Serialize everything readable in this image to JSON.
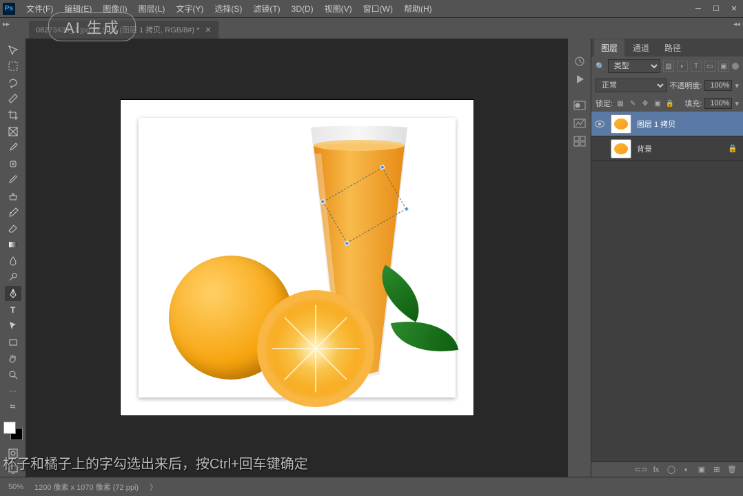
{
  "menu": {
    "items": [
      "文件(F)",
      "编辑(E)",
      "图像(I)",
      "图层(L)",
      "文字(Y)",
      "选择(S)",
      "滤镜(T)",
      "3D(D)",
      "视图(V)",
      "窗口(W)",
      "帮助(H)"
    ]
  },
  "tab": {
    "title": "08273439_1.jpg @ 50% (图层 1 拷贝, RGB/8#) *"
  },
  "ai_badge": "AI 生成",
  "panels": {
    "tabs": [
      "图层",
      "通道",
      "路径"
    ],
    "filter_label": "类型",
    "blend_mode": "正常",
    "opacity_label": "不透明度:",
    "opacity_value": "100%",
    "lock_label": "锁定:",
    "fill_label": "填充:",
    "fill_value": "100%"
  },
  "layers": [
    {
      "name": "图层 1 拷贝",
      "visible": true,
      "selected": true,
      "locked": false
    },
    {
      "name": "背景",
      "visible": false,
      "selected": false,
      "locked": true
    }
  ],
  "status": {
    "zoom": "50%",
    "dimensions": "1200 像素 x 1070 像素 (72 ppi)"
  },
  "subtitle": "杯子和橘子上的字勾选出来后，按Ctrl+回车键确定"
}
